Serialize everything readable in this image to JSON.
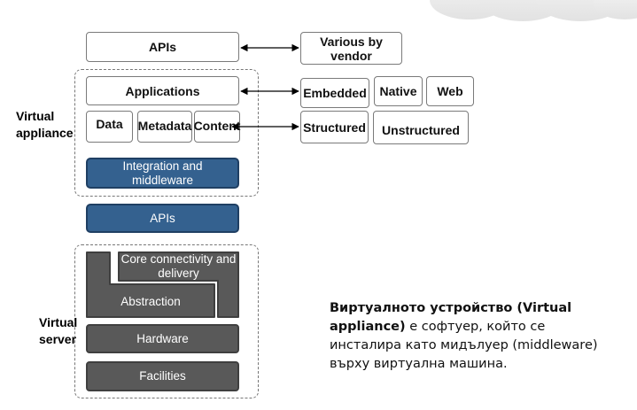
{
  "top_apis": "APIs",
  "various_by_vendor": "Various by vendor",
  "applications": "Applications",
  "app_types": [
    "Embedded",
    "Native",
    "Web"
  ],
  "data_items": [
    "Data",
    "Metadata",
    "Content"
  ],
  "data_types": [
    "Structured",
    "Unstructured"
  ],
  "integration": "Integration and middleware",
  "apis_middle": "APIs",
  "virtual_appliance_label": "Virtual appliance",
  "core_connectivity": "Core connectivity and delivery",
  "abstraction": "Abstraction",
  "hardware": "Hardware",
  "facilities": "Facilities",
  "virtual_server_label": "Virtual server",
  "caption": {
    "bold": "Виртуалното устройство (Virtual appliance)",
    "rest": " е софтуер, който се инсталира като мидълуер (middleware) върху виртуална машина."
  },
  "colors": {
    "blue": "#34618f",
    "gray": "#595959"
  }
}
